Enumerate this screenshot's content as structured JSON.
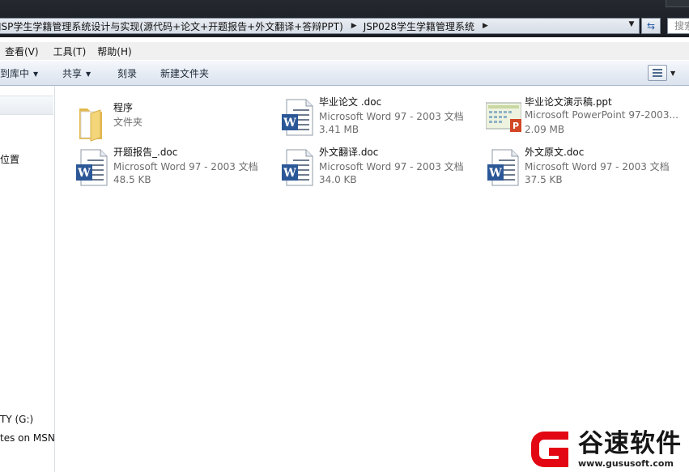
{
  "address": {
    "crumbs": [
      "JSP学生学籍管理系统设计与实现(源代码+论文+开题报告+外文翻译+答辩PPT)",
      "JSP028学生学籍管理系统"
    ],
    "search_placeholder": "搜索"
  },
  "menu": [
    "查看(V)",
    "工具(T)",
    "帮助(H)"
  ],
  "commands": {
    "include_library": "到库中",
    "share": "共享",
    "burn": "刻录",
    "new_folder": "新建文件夹"
  },
  "nav": {
    "items": [
      "位置",
      "TY (G:)",
      "tes on MSN"
    ]
  },
  "files": [
    {
      "name": "程序",
      "type": "文件夹",
      "size": "",
      "icon": "folder-icon"
    },
    {
      "name": "毕业论文 .doc",
      "type": "Microsoft Word 97 - 2003 文档",
      "size": "3.41 MB",
      "icon": "word-doc-icon"
    },
    {
      "name": "毕业论文演示稿.ppt",
      "type": "Microsoft PowerPoint 97-2003...",
      "size": "2.09 MB",
      "icon": "powerpoint-icon"
    },
    {
      "name": "开题报告_.doc",
      "type": "Microsoft Word 97 - 2003 文档",
      "size": "48.5 KB",
      "icon": "word-doc-icon"
    },
    {
      "name": "外文翻译.doc",
      "type": "Microsoft Word 97 - 2003 文档",
      "size": "34.0 KB",
      "icon": "word-doc-icon"
    },
    {
      "name": "外文原文.doc",
      "type": "Microsoft Word 97 - 2003 文档",
      "size": "37.5 KB",
      "icon": "word-doc-icon"
    }
  ],
  "watermark": {
    "text": "谷速软件",
    "url": "www.gususoft.com"
  },
  "colors": {
    "word_blue": "#2b5797",
    "ppt_orange": "#d24726",
    "watermark_red": "#e30613",
    "folder_yellow": "#f3d57a"
  }
}
